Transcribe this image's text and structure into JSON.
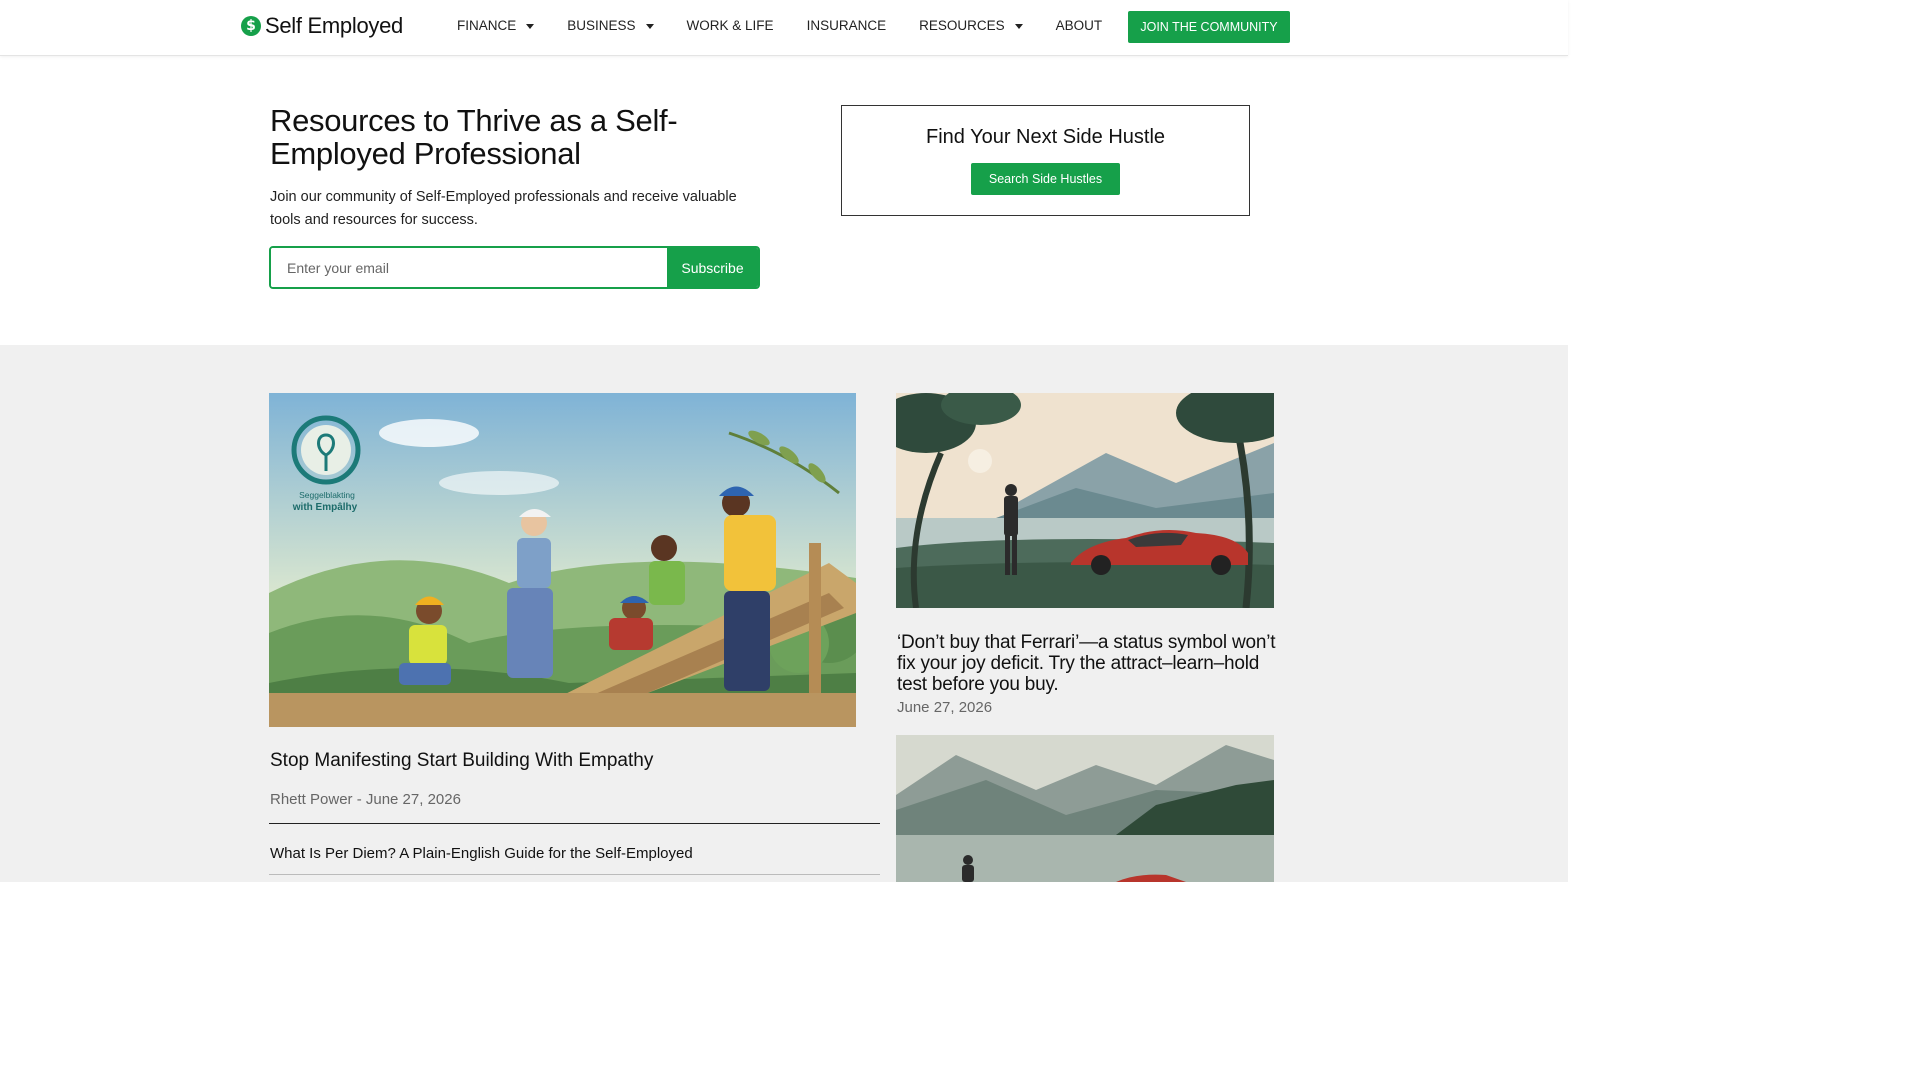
{
  "header": {
    "logo_symbol": "$",
    "logo_text": "Self Employed",
    "nav": [
      {
        "label": "FINANCE",
        "dropdown": true
      },
      {
        "label": "BUSINESS",
        "dropdown": true
      },
      {
        "label": "WORK & LIFE",
        "dropdown": false
      },
      {
        "label": "INSURANCE",
        "dropdown": false
      },
      {
        "label": "RESOURCES",
        "dropdown": true
      },
      {
        "label": "ABOUT",
        "dropdown": false
      }
    ],
    "join_label": "JOIN THE COMMUNITY"
  },
  "hero": {
    "title": "Resources to Thrive as a Self-Employed Professional",
    "description": "Join our community of Self-Employed professionals and receive valuable tools and resources for success.",
    "email_placeholder": "Enter your email",
    "subscribe_label": "Subscribe"
  },
  "side_hustle": {
    "title": "Find Your Next Side Hustle",
    "button_label": "Search Side Hustles"
  },
  "featured": {
    "image_caption_line1": "Seggelblakting",
    "image_caption_line2": "with Empâlhy",
    "title": "Stop Manifesting Start Building With Empathy",
    "meta": "Rhett Power - June 27, 2026",
    "related_link": "What Is Per Diem? A Plain-English Guide for the Self-Employed"
  },
  "side_articles": [
    {
      "title": "‘Don’t buy that Ferrari’—a status symbol won’t fix your joy deficit. Try the attract–learn–hold test before you buy.",
      "date": "June 27, 2026"
    }
  ],
  "colors": {
    "brand_green": "#16a04a",
    "gray_bg": "#f0f0f0"
  }
}
